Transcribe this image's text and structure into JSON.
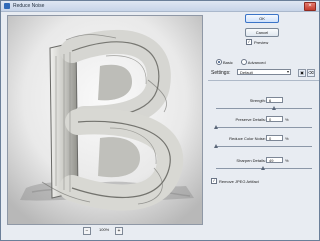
{
  "window": {
    "title": "Reduce Noise"
  },
  "preview": {
    "zoom_label": "100%"
  },
  "buttons": {
    "ok": "OK",
    "cancel": "Cancel"
  },
  "options": {
    "preview_label": "Preview",
    "basic_label": "Basic",
    "advanced_label": "Advanced"
  },
  "settings": {
    "label": "Settings:",
    "value": "Default"
  },
  "params": [
    {
      "label": "Strength:",
      "value": "6",
      "unit": "",
      "slider_fraction": 0.6
    },
    {
      "label": "Preserve Details:",
      "value": "0",
      "unit": "%",
      "slider_fraction": 0.0
    },
    {
      "label": "Reduce Color Noise:",
      "value": "0",
      "unit": "%",
      "slider_fraction": 0.0
    },
    {
      "label": "Sharpen Details:",
      "value": "49",
      "unit": "%",
      "slider_fraction": 0.49
    }
  ],
  "remove_jpeg": {
    "label": "Remove JPEG Artifact",
    "checked": true
  },
  "icons": {
    "zoom_out": "minus-icon",
    "zoom_in": "plus-icon",
    "save_settings": "save-icon",
    "delete_settings": "trash-icon",
    "close": "close-icon"
  }
}
